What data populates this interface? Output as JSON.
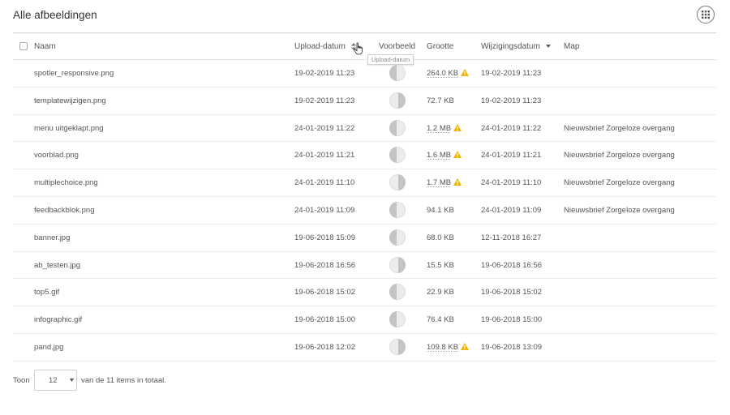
{
  "header": {
    "title": "Alle afbeeldingen",
    "view_icon": "grid-icon"
  },
  "table": {
    "columns": {
      "name": "Naam",
      "upload": "Upload-datum",
      "preview": "Voorbeeld",
      "size": "Grootte",
      "modified": "Wijzigingsdatum",
      "map": "Map"
    },
    "tooltip": "Upload-datum",
    "rows": [
      {
        "name": "spotler_responsive.png",
        "upload": "19-02-2019 11:23",
        "size": "264.0 KB",
        "warning": true,
        "modified": "19-02-2019 11:23",
        "map": ""
      },
      {
        "name": "templatewijzigen.png",
        "upload": "19-02-2019 11:23",
        "size": "72.7 KB",
        "warning": false,
        "modified": "19-02-2019 11:23",
        "map": ""
      },
      {
        "name": "menu uitgeklapt.png",
        "upload": "24-01-2019 11:22",
        "size": "1.2 MB",
        "warning": true,
        "modified": "24-01-2019 11:22",
        "map": "Nieuwsbrief Zorgeloze overgang"
      },
      {
        "name": "voorblad.png",
        "upload": "24-01-2019 11:21",
        "size": "1.6 MB",
        "warning": true,
        "modified": "24-01-2019 11:21",
        "map": "Nieuwsbrief Zorgeloze overgang"
      },
      {
        "name": "multiplechoice.png",
        "upload": "24-01-2019 11:10",
        "size": "1.7 MB",
        "warning": true,
        "modified": "24-01-2019 11:10",
        "map": "Nieuwsbrief Zorgeloze overgang"
      },
      {
        "name": "feedbackblok.png",
        "upload": "24-01-2019 11:09",
        "size": "94.1 KB",
        "warning": false,
        "modified": "24-01-2019 11:09",
        "map": "Nieuwsbrief Zorgeloze overgang"
      },
      {
        "name": "banner.jpg",
        "upload": "19-06-2018 15:09",
        "size": "68.0 KB",
        "warning": false,
        "modified": "12-11-2018 16:27",
        "map": ""
      },
      {
        "name": "ab_testen.jpg",
        "upload": "19-06-2018 16:56",
        "size": "15.5 KB",
        "warning": false,
        "modified": "19-06-2018 16:56",
        "map": ""
      },
      {
        "name": "top5.gif",
        "upload": "19-06-2018 15:02",
        "size": "22.9 KB",
        "warning": false,
        "modified": "19-06-2018 15:02",
        "map": ""
      },
      {
        "name": "infographic.gif",
        "upload": "19-06-2018 15:00",
        "size": "76.4 KB",
        "warning": false,
        "modified": "19-06-2018 15:00",
        "map": ""
      },
      {
        "name": "pand.jpg",
        "upload": "19-06-2018 12:02",
        "size": "109.8 KB",
        "warning": true,
        "modified": "19-06-2018 13:09",
        "map": ""
      }
    ]
  },
  "footer": {
    "show_label": "Toon",
    "page_size": "12",
    "total_text": "van de 11 items in totaal."
  },
  "colors": {
    "warning": "#f0b400",
    "text": "#555555",
    "border": "#e3e3e3"
  }
}
